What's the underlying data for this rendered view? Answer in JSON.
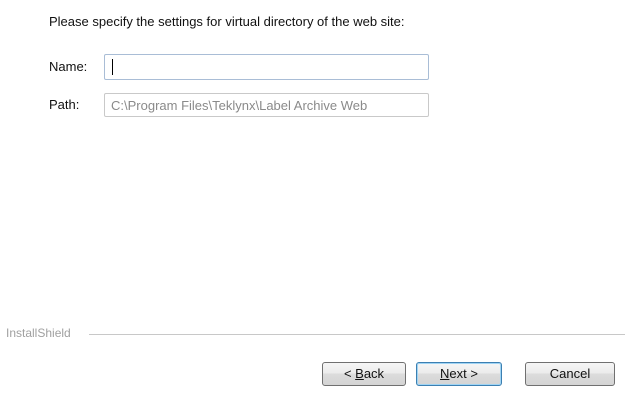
{
  "instruction": "Please specify the settings for virtual directory of the web site:",
  "name_field": {
    "label": "Name:",
    "value": ""
  },
  "path_field": {
    "label": "Path:",
    "value": "C:\\Program Files\\Teklynx\\Label Archive Web"
  },
  "footer": {
    "brand": "InstallShield"
  },
  "buttons": {
    "back": {
      "prefix": "< ",
      "accel": "B",
      "rest": "ack"
    },
    "next": {
      "accel": "N",
      "rest": "ext >"
    },
    "cancel": "Cancel"
  }
}
